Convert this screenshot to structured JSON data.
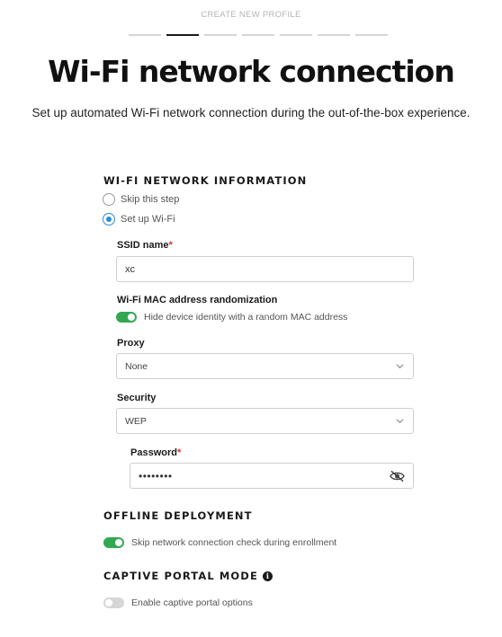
{
  "header": {
    "label": "CREATE NEW PROFILE"
  },
  "stepper": {
    "total": 7,
    "active_index": 1
  },
  "title": "Wi-Fi network connection",
  "subtitle": "Set up automated Wi-Fi network connection during the out-of-the-box experience.",
  "wifi_section": {
    "title": "WI-FI NETWORK INFORMATION",
    "options": [
      {
        "label": "Skip this step",
        "checked": false
      },
      {
        "label": "Set up Wi-Fi",
        "checked": true
      }
    ],
    "ssid": {
      "label": "SSID name",
      "required_mark": "*",
      "value": "xc"
    },
    "mac": {
      "label": "Wi-Fi MAC address randomization",
      "toggle_label": "Hide device identity with a random MAC address",
      "enabled": true
    },
    "proxy": {
      "label": "Proxy",
      "value": "None"
    },
    "security": {
      "label": "Security",
      "value": "WEP"
    },
    "password": {
      "label": "Password",
      "required_mark": "*",
      "value": "••••••••"
    }
  },
  "offline_section": {
    "title": "OFFLINE DEPLOYMENT",
    "toggle_label": "Skip network connection check during enrollment",
    "enabled": true
  },
  "captive_section": {
    "title": "CAPTIVE PORTAL MODE",
    "info_icon": "i",
    "toggle_label": "Enable captive portal options",
    "enabled": false
  },
  "colors": {
    "accent_blue": "#2a8bd6",
    "toggle_green": "#32a852",
    "required_red": "#d62f2f"
  }
}
